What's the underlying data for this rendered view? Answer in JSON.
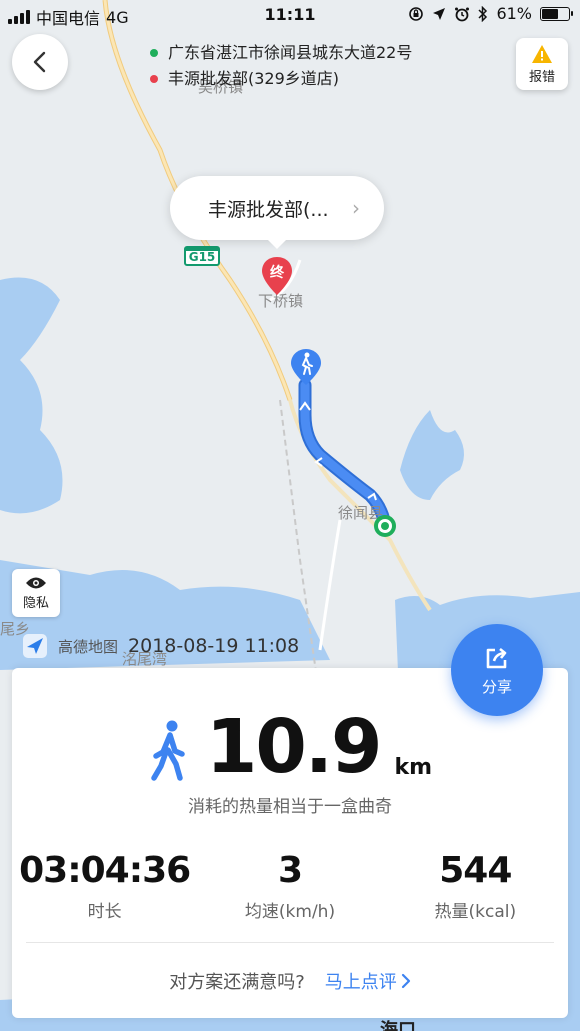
{
  "status_bar": {
    "carrier": "中国电信",
    "network": "4G",
    "time": "11:11",
    "battery": "61%",
    "battery_level": 0.61
  },
  "route": {
    "start": "广东省湛江市徐闻县城东大道22号",
    "end": "丰源批发部(329乡道店)",
    "start_color": "#1fae5b",
    "end_color": "#e8414d"
  },
  "report": {
    "label": "报错"
  },
  "callout": {
    "text": "丰源批发部(...",
    "chevron": "›"
  },
  "map": {
    "highway_badge": "G15",
    "end_marker": "终",
    "labels": {
      "town_top": "吴桥镇",
      "town_end": "下桥镇",
      "county": "徐闻县",
      "bay": "洺尾湾",
      "left_edge": "尾乡",
      "haikou": "海口"
    },
    "water_color": "#a9cdf2",
    "land_color": "#e9edf0",
    "route_color": "#3d83f0"
  },
  "privacy": {
    "label": "隐私"
  },
  "watermark": {
    "brand": "高德地图",
    "datetime": "2018-08-19 11:08"
  },
  "share": {
    "label": "分享"
  },
  "summary": {
    "distance": "10.9",
    "unit": "km",
    "calorie_note": "消耗的热量相当于一盒曲奇",
    "stats": [
      {
        "value": "03:04:36",
        "label": "时长"
      },
      {
        "value": "3",
        "label": "均速(km/h)"
      },
      {
        "value": "544",
        "label": "热量(kcal)"
      }
    ]
  },
  "feedback": {
    "question": "对方案还满意吗?",
    "action": "马上点评"
  }
}
